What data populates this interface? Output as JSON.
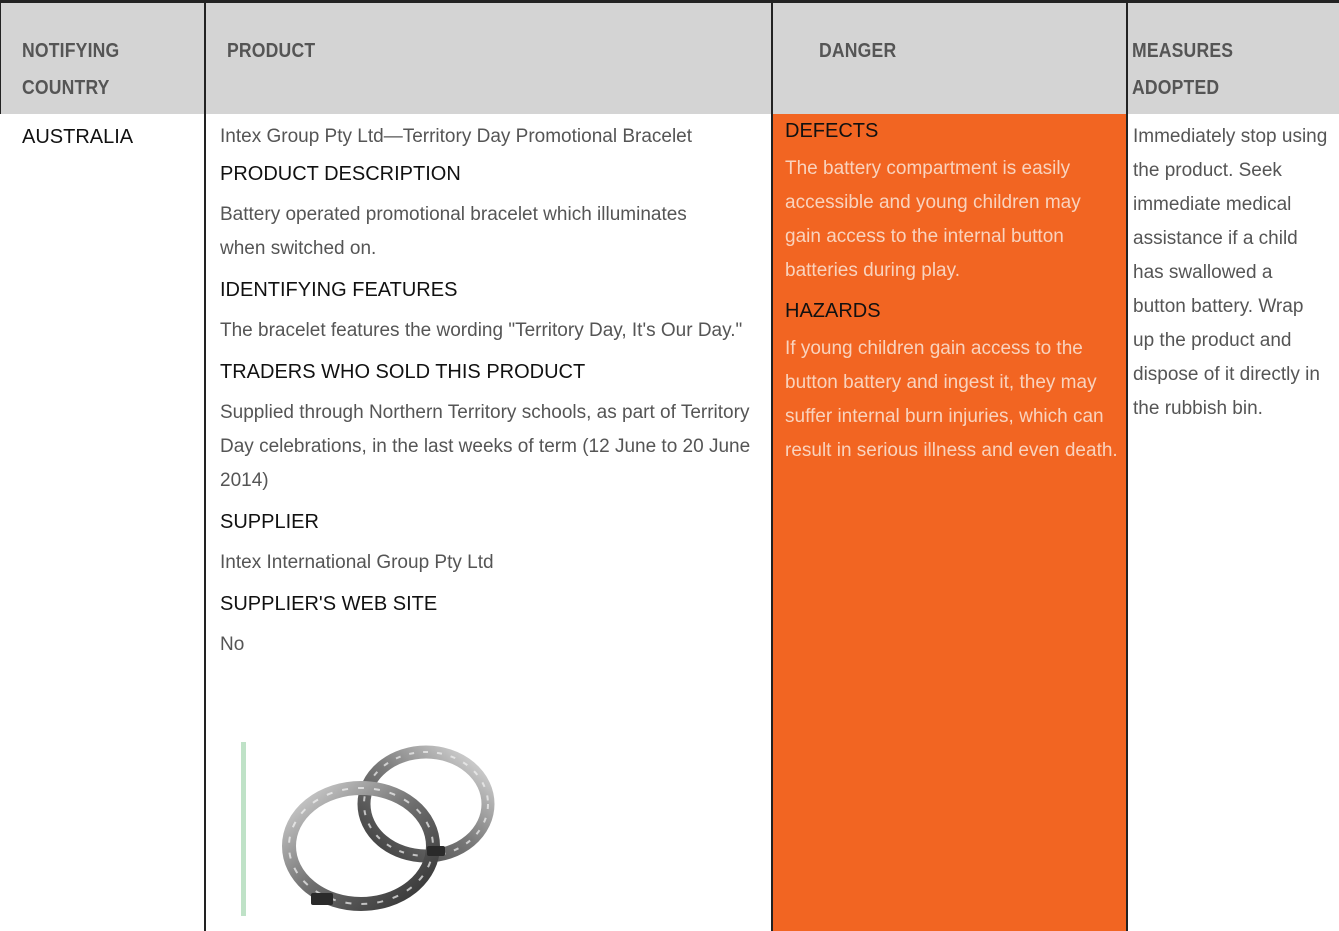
{
  "headers": {
    "country": "NOTIFYING COUNTRY",
    "product": "PRODUCT",
    "danger": "DANGER",
    "measures": "MEASURES ADOPTED"
  },
  "row": {
    "country": "AUSTRALIA",
    "product": {
      "title": "Intex Group Pty Ltd—Territory Day Promotional Bracelet",
      "sections": [
        {
          "heading": "PRODUCT DESCRIPTION",
          "text": "Battery operated promotional bracelet which illuminates when switched on."
        },
        {
          "heading": "IDENTIFYING FEATURES",
          "text": "The bracelet features the wording \"Territory Day, It's Our Day.\""
        },
        {
          "heading": "TRADERS WHO SOLD THIS PRODUCT",
          "text": "Supplied through Northern Territory schools, as part of Territory Day celebrations, in the last weeks of term (12 June to 20 June 2014)"
        },
        {
          "heading": "SUPPLIER",
          "text": "Intex International Group Pty Ltd"
        },
        {
          "heading": "SUPPLIER'S WEB SITE",
          "text": "No"
        }
      ],
      "image_icon": "bracelet-image"
    },
    "danger": {
      "defects_heading": "DEFECTS",
      "defects_text": "The battery compartment is easily accessible and young children may gain access to the internal button batteries during play.",
      "hazards_heading": "HAZARDS",
      "hazards_text": "If young children gain access to the button battery and ingest it, they may suffer internal burn injuries, which can result in serious illness and even death."
    },
    "measures": "Immediately stop using the product. Seek immediate medical assistance if a child has swallowed a button battery. Wrap up the product and dispose of it directly in the rubbish bin."
  },
  "colors": {
    "header_bg": "#d4d4d4",
    "danger_bg": "#f26522",
    "grid_line": "#222222"
  }
}
